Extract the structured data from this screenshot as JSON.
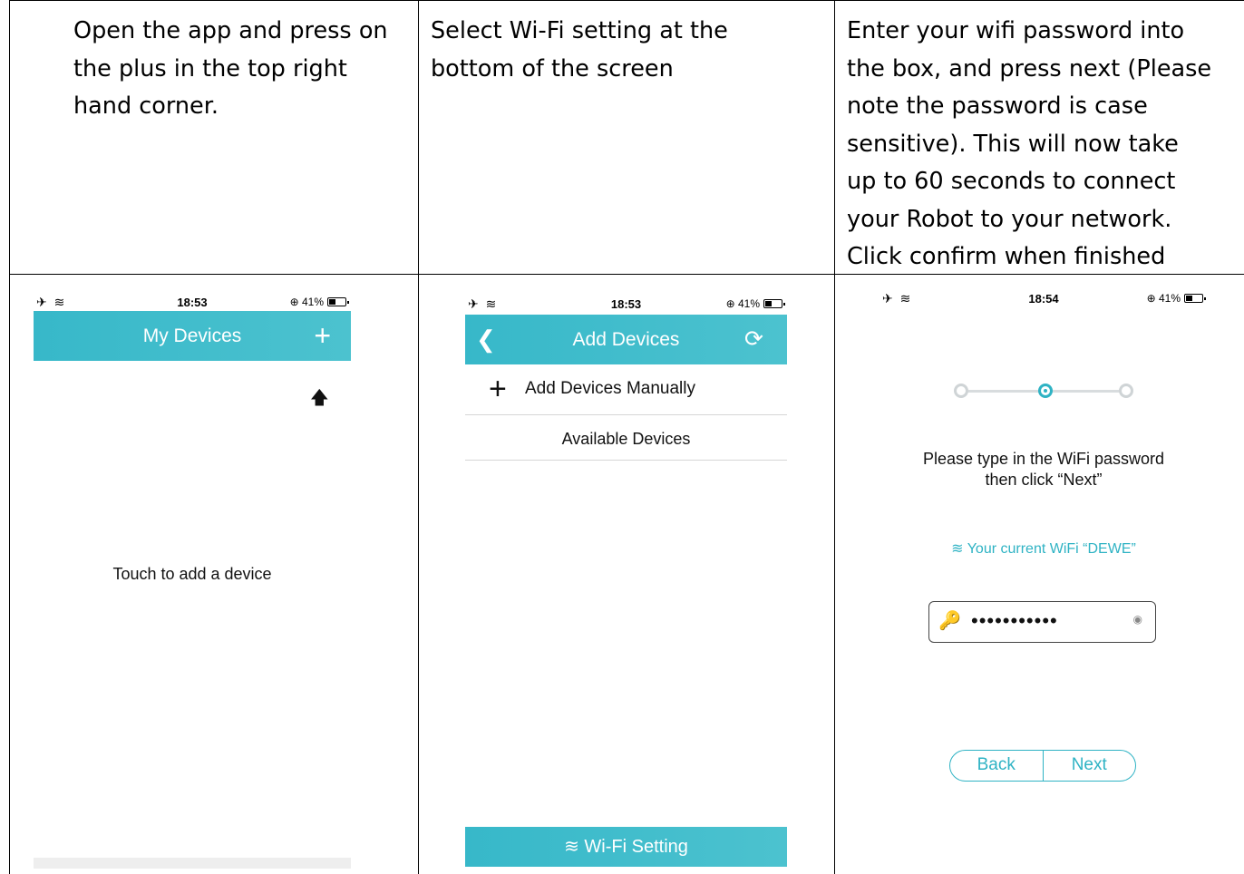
{
  "instructions": {
    "step1": "Open the app and press on\nthe plus in the top right\nhand corner.",
    "step2": "Select Wi-Fi setting at the\nbottom of the screen",
    "step3": "Enter your wifi password into\nthe box, and press next (Please\nnote the password is case\nsensitive).    This will now take\nup to 60 seconds to connect\nyour Robot to your network.\nClick confirm when finished"
  },
  "screen1": {
    "status_time": "18:53",
    "status_battery": "⊕ 41%",
    "title": "My Devices",
    "plus": "+",
    "arrow": "🡅",
    "touch_text": "Touch to add a device"
  },
  "screen2": {
    "status_time": "18:53",
    "status_battery": "⊕ 41%",
    "title": "Add Devices",
    "back": "❮",
    "refresh": "⟳",
    "add_manually": "Add Devices Manually",
    "available": "Available Devices",
    "wifi_setting": "Wi-Fi Setting"
  },
  "screen3": {
    "status_time": "18:54",
    "status_battery": "⊕ 41%",
    "prompt_line1": "Please type in the WiFi password",
    "prompt_line2": "then click “Next”",
    "current_wifi": "Your current WiFi “DEWE”",
    "password_mask": "•••••••••••",
    "back": "Back",
    "next": "Next"
  },
  "icons": {
    "status_left": "✈ ≋",
    "wifi": "≋",
    "key": "🔑",
    "eye": "◉"
  }
}
